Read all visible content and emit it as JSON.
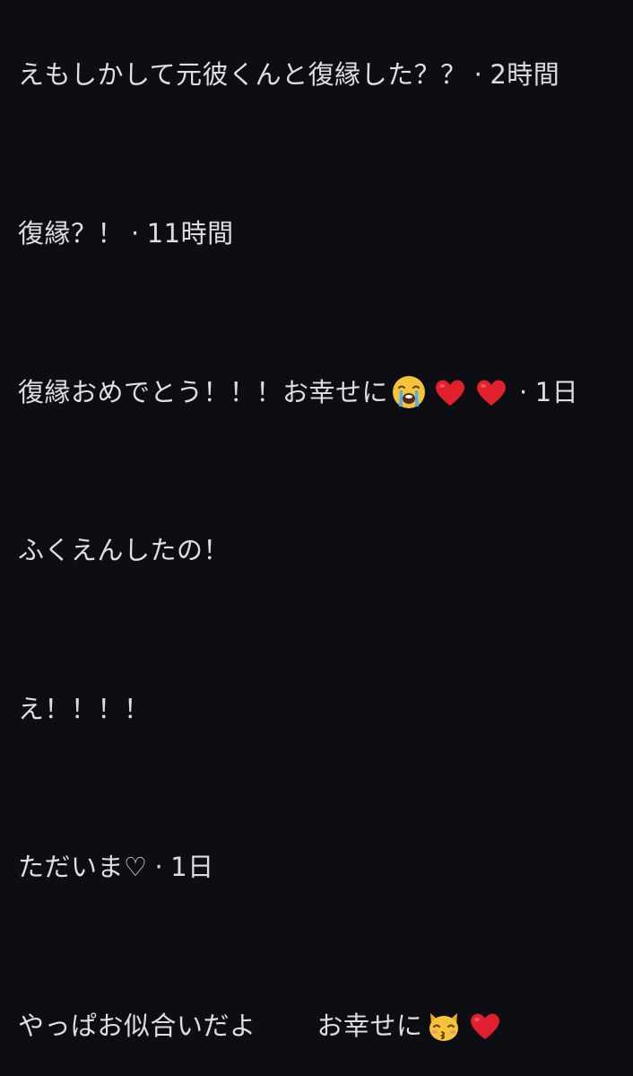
{
  "messages": [
    {
      "text": "えもしかして元彼くんと復縁した？？",
      "time": "2時間"
    },
    {
      "text": "復縁？！",
      "time": "11時間"
    },
    {
      "text": "復縁おめでとう！！！お幸せに",
      "time": "1日"
    },
    {
      "text": "ふくえんしたの！"
    },
    {
      "text": "え！！！！"
    },
    {
      "text": "ただいま♡",
      "time": "1日"
    },
    {
      "text_a": "やっぱお似合いだよ",
      "text_b": "お幸せに"
    }
  ],
  "separator": "·",
  "emoji": {
    "crying": "loudly-crying-face",
    "heart": "red-heart",
    "kiss_cat": "kissing-cat-face"
  },
  "colors": {
    "background": "#0c0e14",
    "text": "#dedfe3",
    "heart": "#e0202c",
    "emoji_face": "#f7c33a"
  }
}
